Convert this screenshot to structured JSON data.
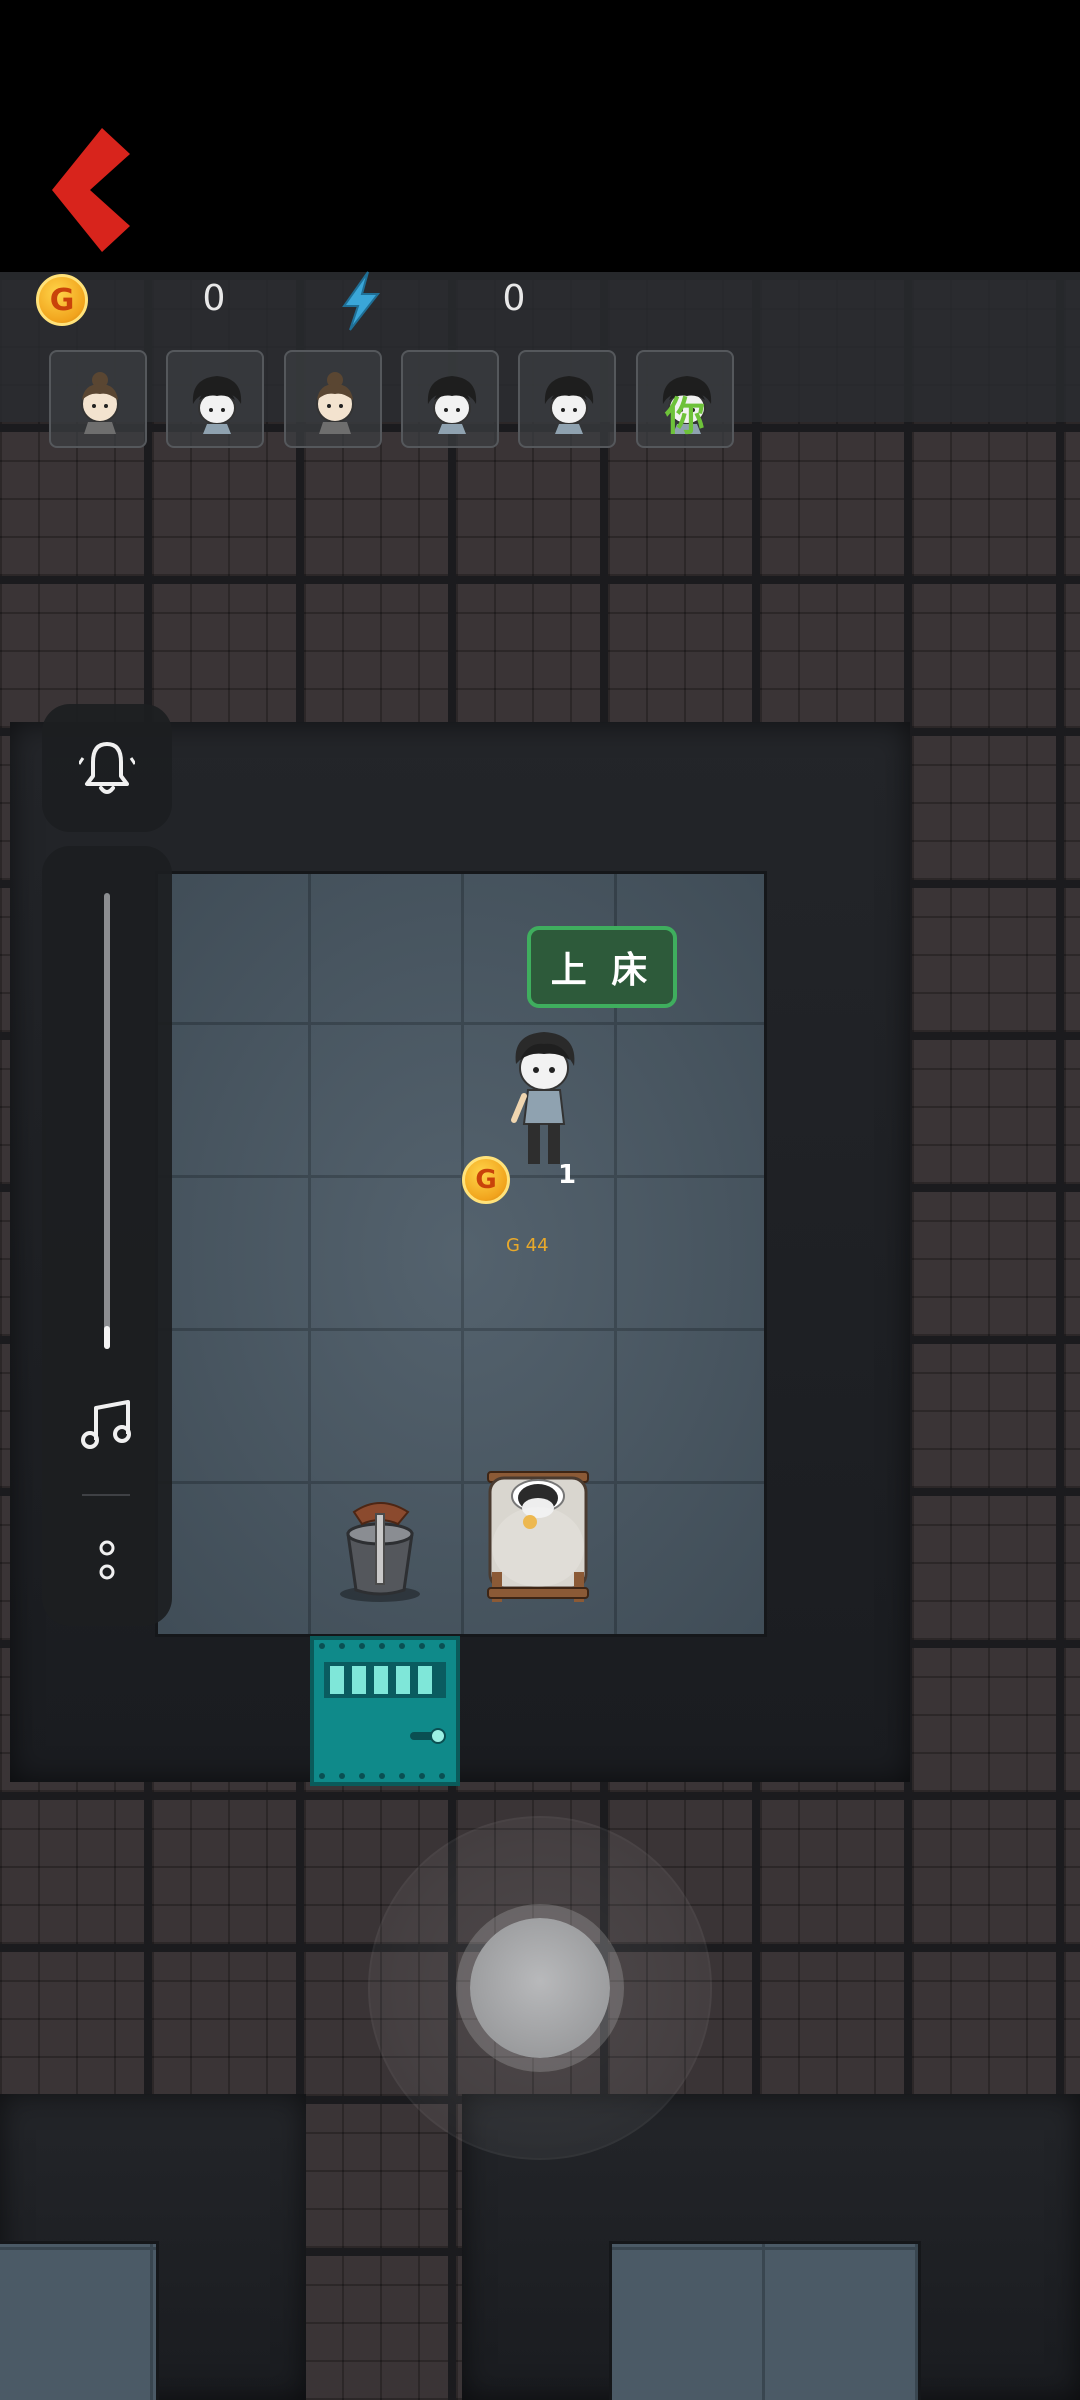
{
  "hud": {
    "coin_symbol": "G",
    "coins": "0",
    "energy": "0",
    "energy_icon": "lightning-icon",
    "back_icon": "chevron-left-icon"
  },
  "players": [
    {
      "avatar": "girl-bun-avatar",
      "tag": ""
    },
    {
      "avatar": "ghost-boy-avatar",
      "tag": ""
    },
    {
      "avatar": "girl-bun-avatar",
      "tag": ""
    },
    {
      "avatar": "ghost-boy-avatar",
      "tag": ""
    },
    {
      "avatar": "ghost-boy-avatar",
      "tag": ""
    },
    {
      "avatar": "ghost-boy-avatar",
      "tag": "你"
    }
  ],
  "side_menu": {
    "bell_icon": "bell-icon",
    "volume_level": 0.05,
    "music_icon": "music-note-icon",
    "more_icon": "more-icon"
  },
  "world": {
    "bed_action_label": "上 床",
    "bed_coin_symbol": "G",
    "bed_level_text": "1",
    "bed_price_text": "G 44"
  },
  "colors": {
    "accent_red": "#d8241c",
    "label_green": "#3fae5e",
    "door_teal": "#0f8a8a"
  }
}
